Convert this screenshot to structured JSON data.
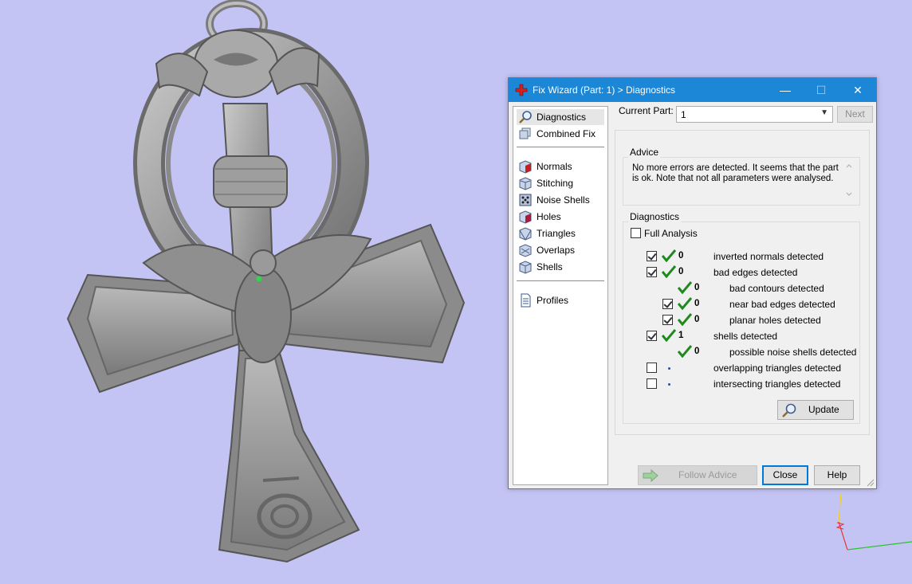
{
  "dialog": {
    "title": "Fix Wizard (Part: 1) > Diagnostics",
    "controls": {
      "minimize": "—",
      "maximize": "☐",
      "close": "✕"
    }
  },
  "nav": {
    "items": [
      {
        "label": "Diagnostics",
        "icon": "magnifier-icon",
        "selected": true
      },
      {
        "label": "Combined Fix",
        "icon": "combined-fix-icon"
      },
      {
        "label": "Normals",
        "icon": "normals-cube-icon"
      },
      {
        "label": "Stitching",
        "icon": "stitching-cube-icon"
      },
      {
        "label": "Noise Shells",
        "icon": "noise-shells-icon"
      },
      {
        "label": "Holes",
        "icon": "holes-cube-icon"
      },
      {
        "label": "Triangles",
        "icon": "triangles-cube-icon"
      },
      {
        "label": "Overlaps",
        "icon": "overlaps-cube-icon"
      },
      {
        "label": "Shells",
        "icon": "shells-cube-icon"
      },
      {
        "label": "Profiles",
        "icon": "document-icon"
      }
    ]
  },
  "current_part": {
    "label": "Current Part:",
    "value": "1",
    "next_label": "Next"
  },
  "advice": {
    "legend": "Advice",
    "text": "No more errors are detected. It seems that the part is ok. Note that not all parameters were analysed."
  },
  "diagnostics": {
    "legend": "Diagnostics",
    "full_analysis_label": "Full Analysis",
    "full_analysis_checked": false,
    "rows": [
      {
        "checked": true,
        "status": "ok",
        "count": "0",
        "label": "inverted normals detected",
        "indent": 0
      },
      {
        "checked": true,
        "status": "ok",
        "count": "0",
        "label": "bad edges detected",
        "indent": 0
      },
      {
        "checked": null,
        "status": "ok",
        "count": "0",
        "label": "bad contours detected",
        "indent": 1
      },
      {
        "checked": true,
        "status": "ok",
        "count": "0",
        "label": "near bad edges detected",
        "indent": 1
      },
      {
        "checked": true,
        "status": "ok",
        "count": "0",
        "label": "planar holes detected",
        "indent": 1
      },
      {
        "checked": true,
        "status": "ok",
        "count": "1",
        "label": "shells detected",
        "indent": 0
      },
      {
        "checked": null,
        "status": "ok",
        "count": "0",
        "label": "possible noise shells detected",
        "indent": 1
      },
      {
        "checked": false,
        "status": "pending",
        "count": "",
        "label": "overlapping triangles detected",
        "indent": 0
      },
      {
        "checked": false,
        "status": "pending",
        "count": "",
        "label": "intersecting triangles detected",
        "indent": 0
      }
    ],
    "update_label": "Update"
  },
  "footer": {
    "follow_advice_label": "Follow Advice",
    "close_label": "Close",
    "help_label": "Help"
  },
  "colors": {
    "viewport_background": "#c4c4f4",
    "titlebar": "#1b87d6",
    "check_green": "#1e8a1e"
  }
}
